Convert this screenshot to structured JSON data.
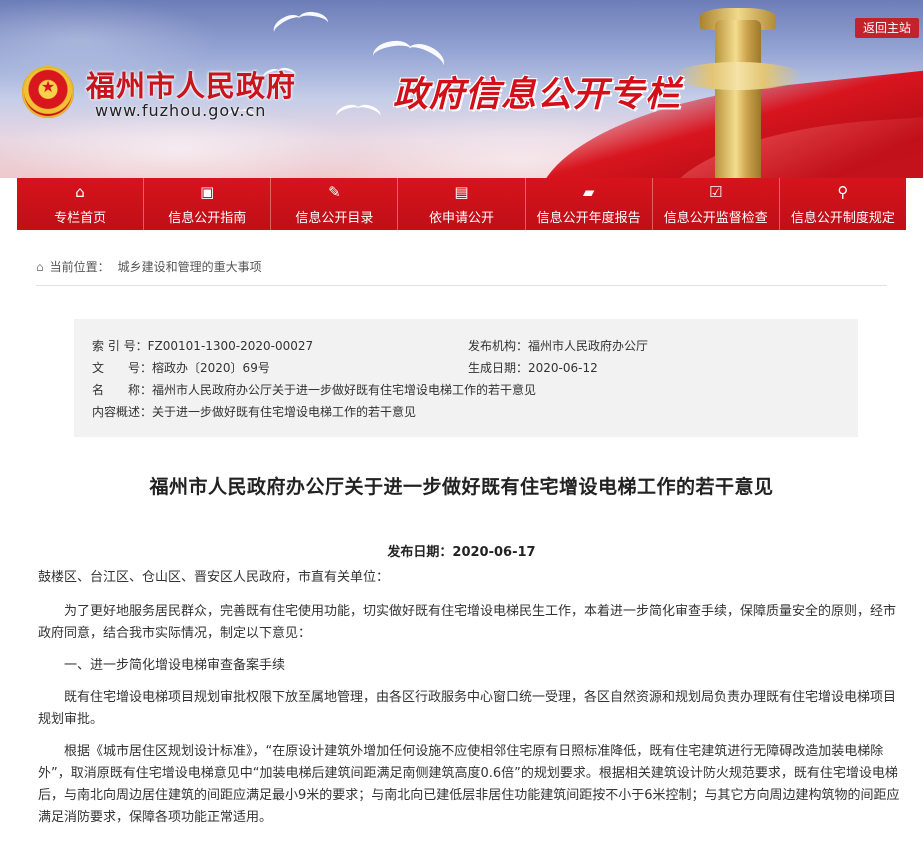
{
  "header": {
    "site_name": "福州市人民政府",
    "site_url": "www.fuzhou.gov.cn",
    "column_title": "政府信息公开专栏",
    "back_home": "返回主站"
  },
  "nav": {
    "items": [
      {
        "label": "专栏首页",
        "icon": "home-icon",
        "glyph": "⌂"
      },
      {
        "label": "信息公开指南",
        "icon": "guide-icon",
        "glyph": "▣"
      },
      {
        "label": "信息公开目录",
        "icon": "catalog-icon",
        "glyph": "✎"
      },
      {
        "label": "依申请公开",
        "icon": "document-icon",
        "glyph": "▤"
      },
      {
        "label": "信息公开年度报告",
        "icon": "folder-icon",
        "glyph": "▰"
      },
      {
        "label": "信息公开监督检查",
        "icon": "checklist-icon",
        "glyph": "☑"
      },
      {
        "label": "信息公开制度规定",
        "icon": "search-icon",
        "glyph": "⚲"
      }
    ]
  },
  "breadcrumb": {
    "prefix": "当前位置：",
    "current": "城乡建设和管理的重大事项"
  },
  "meta": {
    "index_key": "索 引 号：",
    "index_value": "FZ00101-1300-2020-00027",
    "publisher_key": "发布机构：",
    "publisher_value": "福州市人民政府办公厅",
    "docno_key": "文　　号：",
    "docno_value": "榕政办〔2020〕69号",
    "created_key": "生成日期：",
    "created_value": "2020-06-12",
    "name_key": "名　　称：",
    "name_value": "福州市人民政府办公厅关于进一步做好既有住宅增设电梯工作的若干意见",
    "summary_key": "内容概述：",
    "summary_value": "关于进一步做好既有住宅增设电梯工作的若干意见"
  },
  "article": {
    "title": "福州市人民政府办公厅关于进一步做好既有住宅增设电梯工作的若干意见",
    "pub_date": "发布日期：2020-06-17",
    "salutation": "鼓楼区、台江区、仓山区、晋安区人民政府，市直有关单位：",
    "p1": "为了更好地服务居民群众，完善既有住宅使用功能，切实做好既有住宅增设电梯民生工作，本着进一步简化审查手续，保障质量安全的原则，经市政府同意，结合我市实际情况，制定以下意见：",
    "h1": "一、进一步简化增设电梯审查备案手续",
    "p2": "既有住宅增设电梯项目规划审批权限下放至属地管理，由各区行政服务中心窗口统一受理，各区自然资源和规划局负责办理既有住宅增设电梯项目规划审批。",
    "p3": "根据《城市居住区规划设计标准》，“在原设计建筑外增加任何设施不应使相邻住宅原有日照标准降低，既有住宅建筑进行无障碍改造加装电梯除外”，取消原既有住宅增设电梯意见中“加装电梯后建筑间距满足南侧建筑高度0.6倍”的规划要求。根据相关建筑设计防火规范要求，既有住宅增设电梯后，与南北向周边居住建筑的间距应满足最小9米的要求；与南北向已建低层非居住功能建筑间距按不小于6米控制；与其它方向周边建构筑物的间距应满足消防要求，保障各项功能正常适用。"
  },
  "colors": {
    "brand_red": "#d3101a",
    "nav_red": "#cc1119",
    "meta_bg": "#f2f2f2"
  }
}
